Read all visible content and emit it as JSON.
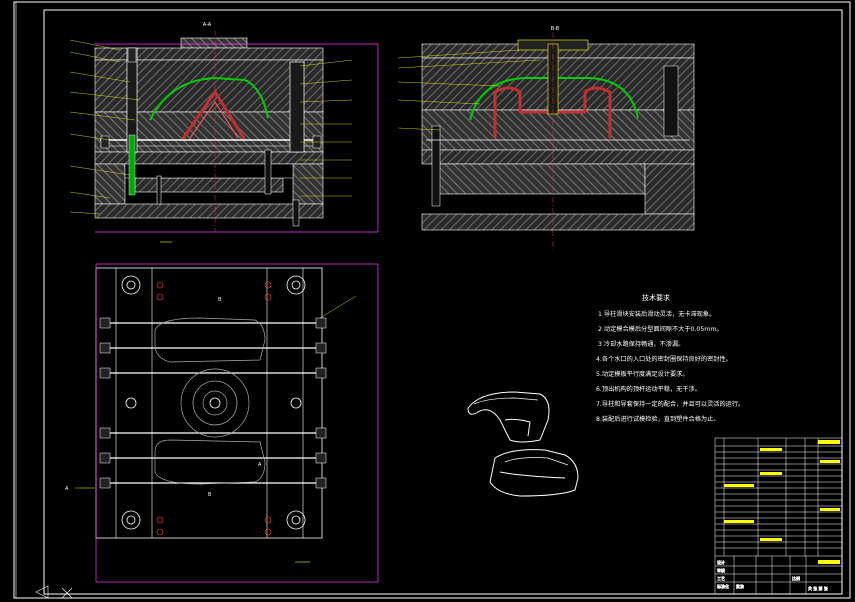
{
  "sheet": {
    "background": "#000000",
    "frame_color": "#ffffff",
    "outline_color": "#ff33ff",
    "hatch_color": "#7a7a7a",
    "cooling_color": "#ffffff",
    "feature_green": "#00cc00",
    "core_red": "#ff3030",
    "highlight_yellow": "#ffff00"
  },
  "views": {
    "front_section_label": "A-A",
    "side_section_label": "B-B",
    "cut_mark_a": "A",
    "cut_mark_b": "B"
  },
  "technical_requirements": {
    "heading": "技术要求",
    "items": [
      "1  导柱滑块安装后滑动灵活，无卡滞现象。",
      "2  动定模合模后分型面间隙不大于0.05mm。",
      "3  冷却水路保持畅通，不渗漏。",
      "4.各个水口的入口处的密封圈保持良好的密封性。",
      "5.动定模板平行度满足设计要求。",
      "6.顶出机构的顶杆运动平稳，无干涉。",
      "7.导柱和导套保持一定的配合，并且可以灵活的运行。",
      "8.装配后进行试模检验，直到塑件合格为止。"
    ]
  },
  "title_block": {
    "row_count": 18,
    "bottom_labels": [
      "设计",
      "审核",
      "工艺",
      "标准化",
      "批准"
    ],
    "scale_label": "比例",
    "sheet_label": "共 张 第 张"
  }
}
